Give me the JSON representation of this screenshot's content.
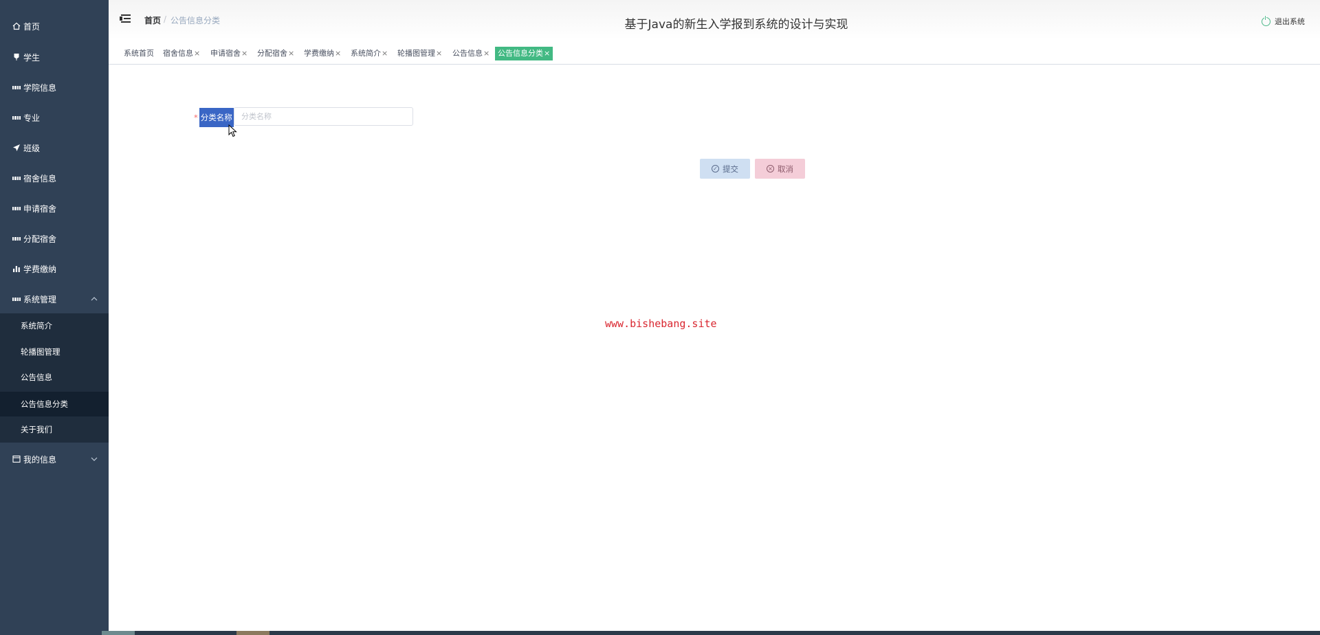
{
  "sidebar": {
    "items": [
      {
        "label": "首页",
        "icon": "home-icon"
      },
      {
        "label": "学生",
        "icon": "user-icon"
      },
      {
        "label": "学院信息",
        "icon": "grid-icon"
      },
      {
        "label": "专业",
        "icon": "grid-icon"
      },
      {
        "label": "班级",
        "icon": "send-icon"
      },
      {
        "label": "宿舍信息",
        "icon": "grid-icon"
      },
      {
        "label": "申请宿舍",
        "icon": "grid-icon"
      },
      {
        "label": "分配宿舍",
        "icon": "grid-icon"
      },
      {
        "label": "学费缴纳",
        "icon": "bar-chart-icon"
      },
      {
        "label": "系统管理",
        "icon": "grid-icon"
      }
    ],
    "submenu": [
      "系统简介",
      "轮播图管理",
      "公告信息",
      "公告信息分类",
      "关于我们"
    ],
    "my_info": "我的信息"
  },
  "header": {
    "breadcrumb_home": "首页",
    "breadcrumb_sep": "/",
    "breadcrumb_current": "公告信息分类",
    "title": "基于Java的新生入学报到系统的设计与实现",
    "logout": "退出系统"
  },
  "tags": [
    {
      "label": "系统首页",
      "closable": false
    },
    {
      "label": "宿舍信息",
      "closable": true
    },
    {
      "label": "申请宿舍",
      "closable": true
    },
    {
      "label": "分配宿舍",
      "closable": true
    },
    {
      "label": "学费缴纳",
      "closable": true
    },
    {
      "label": "系统简介",
      "closable": true
    },
    {
      "label": "轮播图管理",
      "closable": true
    },
    {
      "label": "公告信息",
      "closable": true
    },
    {
      "label": "公告信息分类",
      "closable": true,
      "active": true
    }
  ],
  "tag_close": "×",
  "form": {
    "required_mark": "*",
    "label": "分类名称",
    "placeholder": "分类名称",
    "value": ""
  },
  "buttons": {
    "submit": "提交",
    "cancel": "取消"
  },
  "watermark": "www.bishebang.site",
  "colors": {
    "sidebar_bg": "#304156",
    "submenu_bg": "#1f2d3d",
    "active_tag": "#42b983",
    "label_highlight": "#3a66c5",
    "watermark": "#d9262f"
  }
}
